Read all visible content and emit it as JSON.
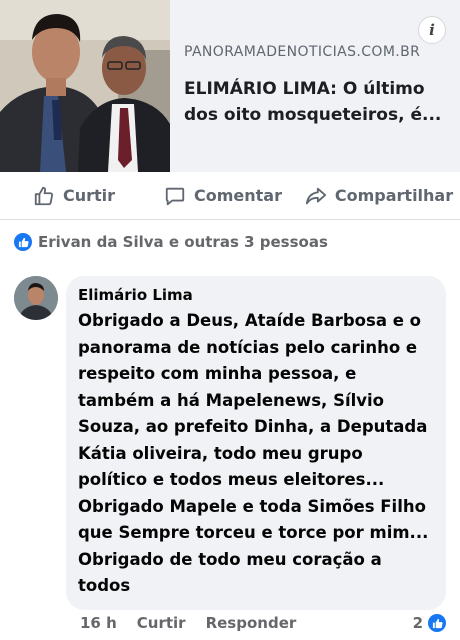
{
  "link_preview": {
    "domain": "PANORAMADENOTICIAS.COM.BR",
    "headline": "ELIMÁRIO LIMA: O último dos oito mosqueteiros, é...",
    "info_icon": "info-icon",
    "info_label": "i"
  },
  "actions": {
    "like_label": "Curtir",
    "comment_label": "Comentar",
    "share_label": "Compartilhar"
  },
  "reactions": {
    "summary": "Erivan da Silva e outras 3 pessoas",
    "icon": "thumbs-up-icon",
    "color": "#1877f2"
  },
  "comment": {
    "author": "Elimário Lima",
    "text": "Obrigado a Deus,  Ataíde Barbosa e o panorama de notícias pelo carinho e respeito com minha pessoa, e também a há Mapelenews, Sílvio Souza, ao prefeito Dinha,  a Deputada Kátia oliveira, todo meu grupo político e todos meus eleitores... Obrigado Mapele e toda Simões Filho que Sempre torceu e torce por mim... Obrigado de todo meu coração a todos",
    "time": "16 h",
    "like_label": "Curtir",
    "reply_label": "Responder",
    "reaction_count": "2"
  }
}
